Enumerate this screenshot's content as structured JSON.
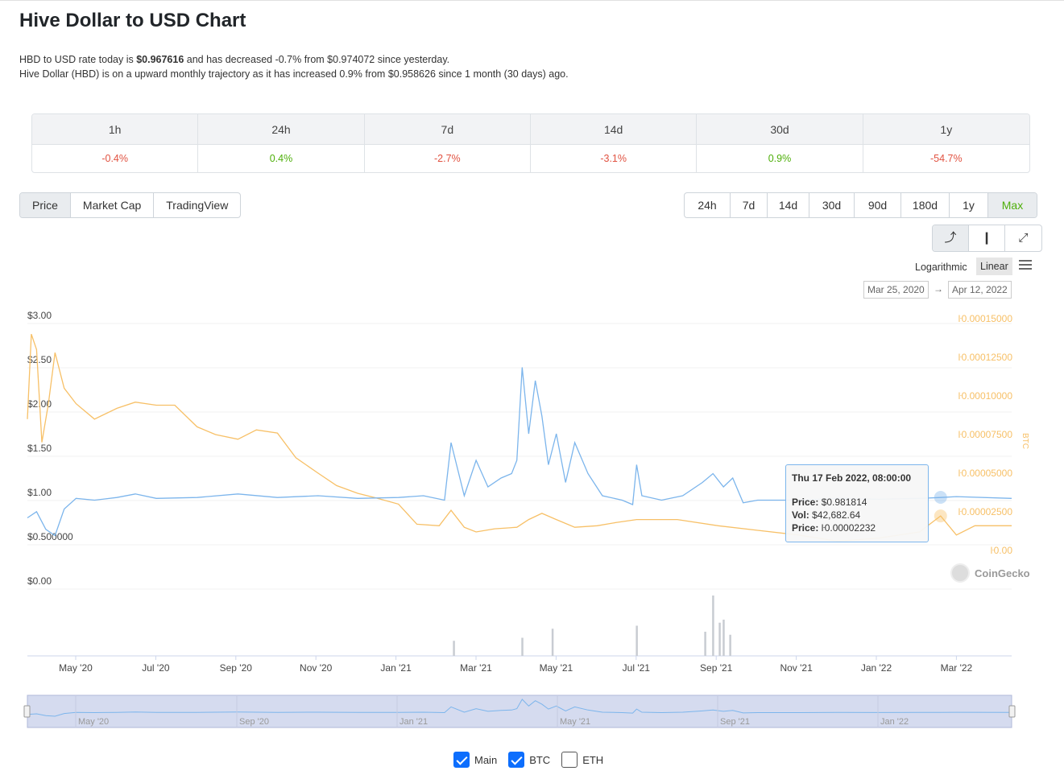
{
  "page": {
    "title": "Hive Dollar to USD Chart",
    "summary": {
      "line1_prefix": "HBD to USD rate today is ",
      "line1_price": "$0.967616",
      "line1_suffix": " and has decreased -0.7% from $0.974072 since yesterday.",
      "line2": "Hive Dollar (HBD) is on a upward monthly trajectory as it has increased 0.9% from $0.958626 since 1 month (30 days) ago."
    }
  },
  "performance": [
    {
      "label": "1h",
      "value": "-0.4%",
      "trend": "neg"
    },
    {
      "label": "24h",
      "value": "0.4%",
      "trend": "pos"
    },
    {
      "label": "7d",
      "value": "-2.7%",
      "trend": "neg"
    },
    {
      "label": "14d",
      "value": "-3.1%",
      "trend": "neg"
    },
    {
      "label": "30d",
      "value": "0.9%",
      "trend": "pos"
    },
    {
      "label": "1y",
      "value": "-54.7%",
      "trend": "neg"
    }
  ],
  "type_tabs": [
    "Price",
    "Market Cap",
    "TradingView"
  ],
  "type_active": "Price",
  "range_tabs": [
    "24h",
    "7d",
    "14d",
    "30d",
    "90d",
    "180d",
    "1y",
    "Max"
  ],
  "range_active": "Max",
  "view_tabs": [
    {
      "icon": "line-chart-icon",
      "glyph": "⤴"
    },
    {
      "icon": "candlestick-icon",
      "glyph": "❙"
    },
    {
      "icon": "fullscreen-icon",
      "glyph": "⤢"
    }
  ],
  "scale": {
    "log": "Logarithmic",
    "linear": "Linear"
  },
  "date_range": {
    "from": "Mar 25, 2020",
    "arrow": "→",
    "to": "Apr 12, 2022"
  },
  "tooltip": {
    "header": "Thu 17 Feb 2022, 08:00:00",
    "price_label": "Price:",
    "price_value": " $0.981814",
    "vol_label": "Vol:",
    "vol_value": " $42,682.64",
    "btc_label": "Price:",
    "btc_value": " ŀ0.00002232"
  },
  "watermark": "CoinGecko",
  "legend": [
    {
      "label": "Main",
      "checked": true
    },
    {
      "label": "BTC",
      "checked": true
    },
    {
      "label": "ETH",
      "checked": false
    }
  ],
  "colors": {
    "usd_line": "#7cb5ec",
    "btc_line": "#f7c067",
    "volume": "#c8ccd2",
    "navigator_bg": "#d5dbef"
  },
  "chart_data": {
    "type": "line",
    "y_left_ticks": [
      "$3.00",
      "$2.50",
      "$2.00",
      "$1.50",
      "$1.00",
      "$0.500000",
      "$0.00"
    ],
    "y_left_range": [
      0,
      3
    ],
    "y_right_ticks": [
      "ŀ0.00015000",
      "ŀ0.00012500",
      "ŀ0.00010000",
      "ŀ0.00007500",
      "ŀ0.00005000",
      "ŀ0.00002500",
      "ŀ0.00"
    ],
    "y_right_range": [
      0,
      0.00015
    ],
    "y_right_label": "BTC",
    "x_ticks": [
      "May '20",
      "Jul '20",
      "Sep '20",
      "Nov '20",
      "Jan '21",
      "Mar '21",
      "May '21",
      "Jul '21",
      "Sep '21",
      "Nov '21",
      "Jan '22",
      "Mar '22"
    ],
    "navigator_ticks": [
      "May '20",
      "Sep '20",
      "Jan '21",
      "May '21",
      "Sep '21",
      "Jan '22"
    ],
    "series": [
      {
        "name": "Main",
        "axis": "left",
        "x": [
          "2020-03-25",
          "2020-04-01",
          "2020-04-08",
          "2020-04-15",
          "2020-04-22",
          "2020-05-01",
          "2020-05-15",
          "2020-06-01",
          "2020-06-15",
          "2020-07-01",
          "2020-08-01",
          "2020-09-01",
          "2020-10-01",
          "2020-11-01",
          "2020-12-01",
          "2021-01-01",
          "2021-01-20",
          "2021-02-05",
          "2021-02-10",
          "2021-02-20",
          "2021-03-01",
          "2021-03-10",
          "2021-03-20",
          "2021-03-28",
          "2021-04-01",
          "2021-04-05",
          "2021-04-10",
          "2021-04-15",
          "2021-04-20",
          "2021-04-25",
          "2021-05-01",
          "2021-05-08",
          "2021-05-15",
          "2021-05-25",
          "2021-06-05",
          "2021-06-20",
          "2021-06-28",
          "2021-07-01",
          "2021-07-05",
          "2021-07-20",
          "2021-08-05",
          "2021-08-20",
          "2021-08-28",
          "2021-09-05",
          "2021-09-12",
          "2021-09-20",
          "2021-10-01",
          "2021-11-01",
          "2021-12-01",
          "2022-01-01",
          "2022-02-01",
          "2022-02-17",
          "2022-03-01",
          "2022-04-12"
        ],
        "y": [
          0.75,
          0.82,
          0.62,
          0.55,
          0.85,
          0.97,
          0.95,
          0.98,
          1.02,
          0.97,
          0.98,
          1.02,
          0.98,
          1.0,
          0.97,
          0.98,
          1.0,
          0.95,
          1.6,
          1.0,
          1.4,
          1.1,
          1.2,
          1.25,
          1.4,
          2.45,
          1.7,
          2.3,
          1.9,
          1.35,
          1.7,
          1.15,
          1.6,
          1.25,
          1.0,
          0.95,
          0.9,
          1.35,
          1.0,
          0.95,
          1.0,
          1.15,
          1.25,
          1.1,
          1.2,
          0.92,
          0.95,
          0.95,
          0.97,
          0.96,
          0.97,
          0.98,
          0.99,
          0.97
        ]
      },
      {
        "name": "BTC",
        "axis": "right",
        "x": [
          "2020-03-25",
          "2020-03-28",
          "2020-04-01",
          "2020-04-05",
          "2020-04-10",
          "2020-04-15",
          "2020-04-22",
          "2020-05-01",
          "2020-05-15",
          "2020-06-01",
          "2020-06-15",
          "2020-07-01",
          "2020-07-15",
          "2020-08-01",
          "2020-08-15",
          "2020-09-01",
          "2020-09-15",
          "2020-10-01",
          "2020-10-15",
          "2020-11-01",
          "2020-11-15",
          "2020-12-01",
          "2020-12-15",
          "2021-01-01",
          "2021-01-15",
          "2021-02-01",
          "2021-02-10",
          "2021-02-20",
          "2021-03-01",
          "2021-03-15",
          "2021-04-01",
          "2021-04-10",
          "2021-04-20",
          "2021-05-01",
          "2021-05-15",
          "2021-06-01",
          "2021-06-15",
          "2021-07-01",
          "2021-08-01",
          "2021-09-01",
          "2021-10-01",
          "2021-11-01",
          "2021-12-01",
          "2022-01-01",
          "2022-02-01",
          "2022-02-17",
          "2022-03-01",
          "2022-03-15",
          "2022-04-12"
        ],
        "y": [
          8.5e-05,
          0.00014,
          0.00013,
          7e-05,
          9.5e-05,
          0.000128,
          0.000105,
          9.5e-05,
          8.5e-05,
          9.2e-05,
          9.6e-05,
          9.4e-05,
          9.4e-05,
          8e-05,
          7.5e-05,
          7.2e-05,
          7.8e-05,
          7.6e-05,
          6e-05,
          5e-05,
          4.2e-05,
          3.7e-05,
          3.4e-05,
          3e-05,
          1.7e-05,
          1.6e-05,
          2.6e-05,
          1.5e-05,
          1.2e-05,
          1.4e-05,
          1.5e-05,
          2e-05,
          2.4e-05,
          2e-05,
          1.5e-05,
          1.6e-05,
          1.8e-05,
          2e-05,
          2e-05,
          1.6e-05,
          1.3e-05,
          1e-05,
          6e-06,
          8e-06,
          1.2e-05,
          2.232e-05,
          1e-05,
          1.6e-05,
          1.6e-05
        ]
      }
    ],
    "volume_spikes": [
      {
        "x": "2021-02-12",
        "v": 0.25
      },
      {
        "x": "2021-04-05",
        "v": 0.3
      },
      {
        "x": "2021-04-28",
        "v": 0.45
      },
      {
        "x": "2021-07-01",
        "v": 0.5
      },
      {
        "x": "2021-08-22",
        "v": 0.4
      },
      {
        "x": "2021-08-28",
        "v": 1.0
      },
      {
        "x": "2021-09-02",
        "v": 0.55
      },
      {
        "x": "2021-09-05",
        "v": 0.6
      },
      {
        "x": "2021-09-10",
        "v": 0.35
      }
    ],
    "tooltip_point": {
      "x": "2022-02-17",
      "price": 0.981814,
      "btc": 2.232e-05
    }
  }
}
